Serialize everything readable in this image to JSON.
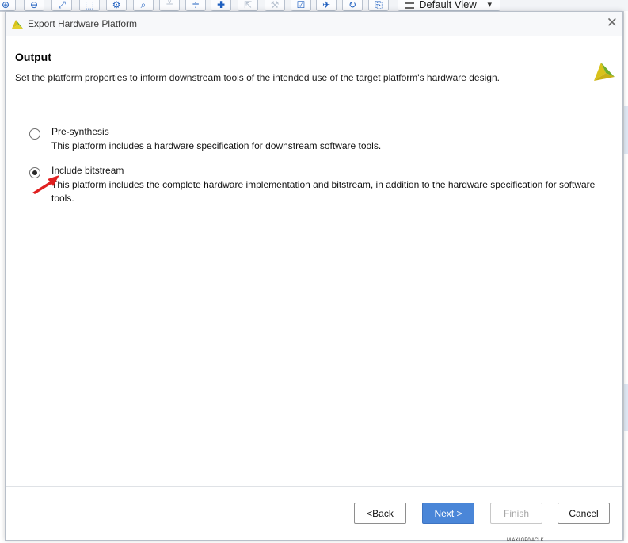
{
  "background": {
    "toolbar": {
      "view_select": "Default View",
      "buttons": [
        "zoom-in",
        "zoom-out",
        "fit",
        "select-area",
        "settings",
        "search",
        "collapse",
        "expand",
        "add",
        "route",
        "wrench",
        "validate",
        "pin",
        "refresh",
        "regenerate"
      ]
    },
    "bottom_label": "M AXI GP0 ACLK"
  },
  "dialog": {
    "title": "Export Hardware Platform",
    "close_glyph": "✕",
    "heading": "Output",
    "description": "Set the platform properties to inform downstream tools of the intended use of the target platform's hardware design.",
    "options": [
      {
        "label": "Pre-synthesis",
        "description": "This platform includes a hardware specification for downstream software tools.",
        "selected": false
      },
      {
        "label": "Include bitstream",
        "description": "This platform includes the complete hardware implementation and bitstream, in addition to the hardware specification for software tools.",
        "selected": true
      }
    ],
    "buttons": {
      "back": {
        "prefix": "< ",
        "mnemonic": "B",
        "rest": "ack",
        "enabled": true
      },
      "next": {
        "mnemonic": "N",
        "rest": "ext >",
        "enabled": true
      },
      "finish": {
        "mnemonic": "F",
        "rest": "inish",
        "enabled": false
      },
      "cancel": {
        "label": "Cancel",
        "enabled": true
      }
    }
  },
  "colors": {
    "accent_blue": "#4a86d8",
    "logo_yellow": "#d9c21a",
    "logo_green": "#6fae2b",
    "arrow_red": "#e02020"
  }
}
